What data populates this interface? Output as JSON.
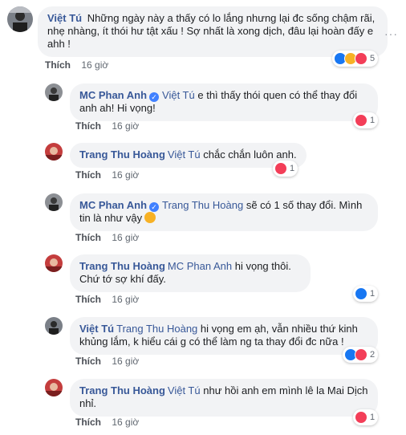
{
  "colors": {
    "link": "#385898",
    "bubble": "#f2f3f5",
    "meta": "#606770"
  },
  "comments": [
    {
      "author": "Việt Tú",
      "verified": false,
      "mention": "",
      "text": "Những ngày này a thấy có lo lắng nhưng lại đc sống chậm rãi, nhẹ nhàng, ít thói hư tật xấu ! Sợ nhất là xong dịch, đâu lại hoàn đấy e ahh !",
      "like": "Thích",
      "time": "16 giờ",
      "reactions": [
        "like",
        "haha",
        "love"
      ],
      "count": "5",
      "more": "···"
    },
    {
      "author": "MC Phan Anh",
      "verified": true,
      "mention": "Việt Tú",
      "text": "e thì thấy thói quen có thể thay đổi anh ah! Hi vọng!",
      "like": "Thích",
      "time": "16 giờ",
      "reactions": [
        "love"
      ],
      "count": "1"
    },
    {
      "author": "Trang Thu Hoàng",
      "verified": false,
      "mention": "Việt Tú",
      "text": "chắc chắn luôn anh.",
      "like": "Thích",
      "time": "16 giờ",
      "reactions": [
        "love"
      ],
      "count": "1"
    },
    {
      "author": "MC Phan Anh",
      "verified": true,
      "mention": "Trang Thu Hoàng",
      "text": "sẽ có 1 số thay đổi. Mình tin là như vậy",
      "like": "Thích",
      "time": "16 giờ",
      "reactions": [],
      "count": ""
    },
    {
      "author": "Trang Thu Hoàng",
      "verified": false,
      "mention": "MC Phan Anh",
      "text": "hi vọng thôi. Chứ tớ sợ khí đấy.",
      "like": "Thích",
      "time": "16 giờ",
      "reactions": [
        "like"
      ],
      "count": "1"
    },
    {
      "author": "Việt Tú",
      "verified": false,
      "mention": "Trang Thu Hoàng",
      "text": "hi vọng em ạh, vẫn nhiều thứ kinh khủng lắm, k hiểu cái g có thể làm ng ta thay đổi đc nữa !",
      "like": "Thích",
      "time": "16 giờ",
      "reactions": [
        "like",
        "love"
      ],
      "count": "2"
    },
    {
      "author": "Trang Thu Hoàng",
      "verified": false,
      "mention": "Việt Tú",
      "text": "như hồi anh em mình lê la Mai Dịch nhỉ.",
      "like": "Thích",
      "time": "16 giờ",
      "reactions": [
        "love"
      ],
      "count": "1"
    }
  ]
}
